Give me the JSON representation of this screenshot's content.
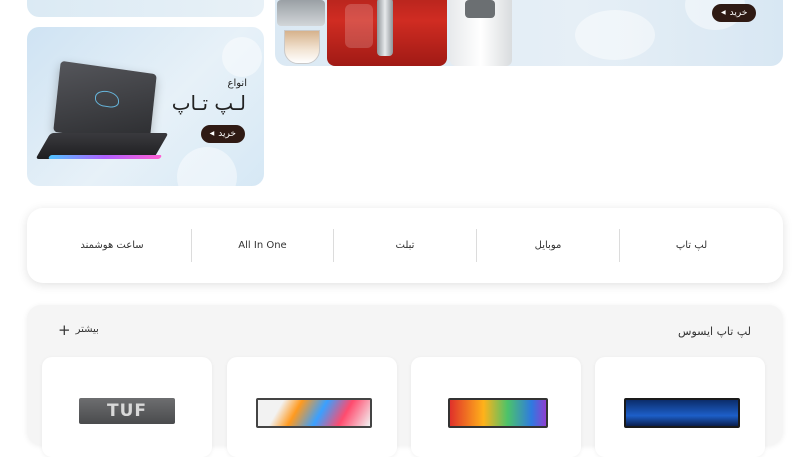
{
  "banners": {
    "laptop": {
      "kicker": "انواع",
      "title": "لـپ تـاپ",
      "buy_label": "خرید"
    },
    "appliance": {
      "buy_label": "خرید"
    }
  },
  "categories": [
    {
      "label": "لپ تاپ"
    },
    {
      "label": "موبایل"
    },
    {
      "label": "تبلت"
    },
    {
      "label": "All In One"
    },
    {
      "label": "ساعت هوشمند"
    }
  ],
  "products_section": {
    "title": "لپ تاپ ایسوس",
    "more_label": "بیشتر",
    "cards": [
      {
        "thumb": "laptop-thumb-dark-blue"
      },
      {
        "thumb": "laptop-thumb-rainbow"
      },
      {
        "thumb": "laptop-thumb-colorful"
      },
      {
        "thumb": "laptop-thumb-tuf",
        "thumb_text": "TUF"
      }
    ]
  },
  "colors": {
    "buy_button": "#2f1a14",
    "banner_bg": "#dbeaf4",
    "fryer_red": "#c0241d"
  }
}
